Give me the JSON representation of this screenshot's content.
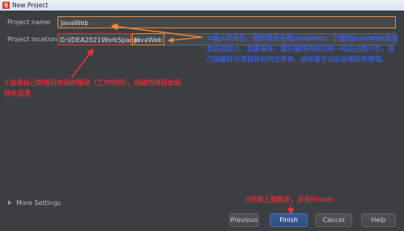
{
  "window": {
    "title": "New Project"
  },
  "form": {
    "project_name_label": "Project name:",
    "project_name_value": "JavaWeb",
    "project_location_label": "Project location:",
    "location_path": "D:\\IDEA2021WorkSpace\\",
    "location_suffix": "JavaWeb"
  },
  "more_settings": "More Settings",
  "annotations": {
    "name_note": "②输入项目名，我的项目名是JavaWeb，下面的JavaWeb应该会自动加上，如果没有，就只能拜托你们动一动自己的小手，自己创建好与项目目名的文件夹，这样便于以后对项目的管理。",
    "location_note": "①选择自己的项目的保存路径（工作空间），创建的项目会保存在这里",
    "finish_note": "③完成上面两步，点击Finish"
  },
  "buttons": {
    "previous": "Previous",
    "finish": "Finish",
    "cancel": "Cancel",
    "help": "Help"
  }
}
